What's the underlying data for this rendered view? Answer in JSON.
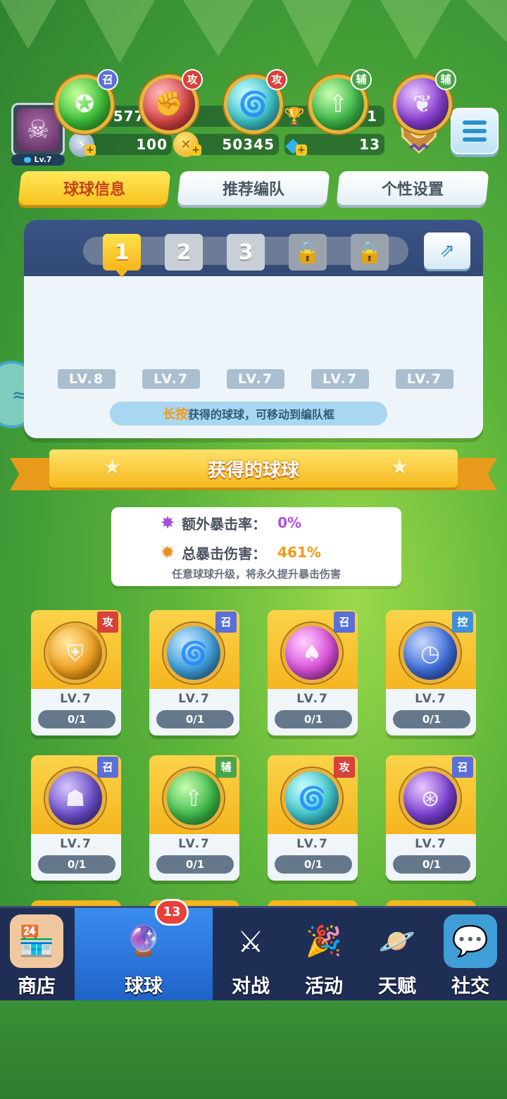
{
  "player": {
    "level": "Lv.7",
    "score": "12657701",
    "trophies": "2601",
    "energy": "100",
    "coins": "50345",
    "gems": "13"
  },
  "tabs": [
    "球球信息",
    "推荐编队",
    "个性设置"
  ],
  "team": {
    "slots": [
      "1",
      "2",
      "3"
    ],
    "balls": [
      {
        "tag": "召",
        "level": "LV.8",
        "icon": "star-ball-icon",
        "color": "#3fbf3a"
      },
      {
        "tag": "攻",
        "level": "LV.7",
        "icon": "fist-ball-icon",
        "color": "#d94848"
      },
      {
        "tag": "攻",
        "level": "LV.7",
        "icon": "tornado-ball-icon",
        "color": "#3fc4c9"
      },
      {
        "tag": "辅",
        "level": "LV.7",
        "icon": "arrow-up-ball-icon",
        "color": "#3fb84a"
      },
      {
        "tag": "辅",
        "level": "LV.7",
        "icon": "leaf-ball-icon",
        "color": "#8a3fd0"
      }
    ],
    "hint_highlight": "长按",
    "hint_text": "获得的球球，可移动到编队框"
  },
  "acquired": {
    "title": "获得的球球",
    "extra_crit_label": "额外暴击率：",
    "extra_crit_value": "0%",
    "total_crit_label": "总暴击伤害：",
    "total_crit_value": "461%",
    "note": "任意球球升级，将永久提升暴击伤害"
  },
  "cards": [
    {
      "tag": "攻",
      "level": "LV.7",
      "progress": "0/1",
      "icon": "knight-ball-icon",
      "color": "#f0a020"
    },
    {
      "tag": "召",
      "level": "LV.7",
      "progress": "0/1",
      "icon": "swirl-ball-icon",
      "color": "#3f9ed8"
    },
    {
      "tag": "召",
      "level": "LV.7",
      "progress": "0/1",
      "icon": "mushroom-ball-icon",
      "color": "#d84fd8"
    },
    {
      "tag": "控",
      "level": "LV.7",
      "progress": "0/1",
      "icon": "clock-ball-icon",
      "color": "#3f6ed8"
    },
    {
      "tag": "召",
      "level": "LV.7",
      "progress": "0/1",
      "icon": "ghost-ball-icon",
      "color": "#6a4fc8"
    },
    {
      "tag": "辅",
      "level": "LV.7",
      "progress": "0/1",
      "icon": "arrow-up-ball-icon",
      "color": "#3fb84a"
    },
    {
      "tag": "攻",
      "level": "LV.7",
      "progress": "0/1",
      "icon": "tornado-ball-icon",
      "color": "#3fc4c9"
    },
    {
      "tag": "召",
      "level": "LV.7",
      "progress": "0/1",
      "icon": "orbit-ball-icon",
      "color": "#7a3fd0"
    }
  ],
  "nav": {
    "shop": "商店",
    "balls": "球球",
    "battle": "对战",
    "events": "活动",
    "talent": "天赋",
    "social": "社交",
    "balls_badge": "13"
  }
}
